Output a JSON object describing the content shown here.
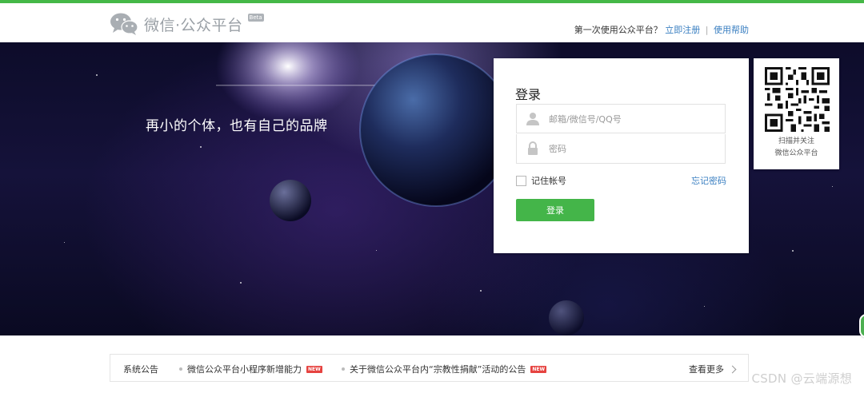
{
  "header": {
    "logo_text": "微信·公众平台",
    "beta_badge": "Beta",
    "first_time_prompt": "第一次使用公众平台？",
    "register_link": "立即注册",
    "separator": "|",
    "help_link": "使用帮助"
  },
  "banner": {
    "slogan": "再小的个体，也有自己的品牌"
  },
  "login": {
    "title": "登录",
    "account_placeholder": "邮箱/微信号/QQ号",
    "password_placeholder": "密码",
    "remember_label": "记住帐号",
    "forgot_link": "忘记密码",
    "submit_label": "登录"
  },
  "qr": {
    "caption_line1": "扫描并关注",
    "caption_line2": "微信公众平台"
  },
  "notices": {
    "title": "系统公告",
    "items": [
      {
        "text": "微信公众平台小程序新增能力",
        "badge": "NEW"
      },
      {
        "text": "关于微信公众平台内“宗教性捐献”活动的公告",
        "badge": "NEW"
      }
    ],
    "more_link": "查看更多"
  },
  "watermark": "CSDN @云端源想",
  "colors": {
    "accent_green": "#44b549",
    "link_blue": "#3a7fc1",
    "new_badge_red": "#e64340"
  },
  "icons": [
    "wechat-logo-icon",
    "user-icon",
    "lock-icon",
    "qr-code-icon",
    "chevron-right-icon"
  ]
}
